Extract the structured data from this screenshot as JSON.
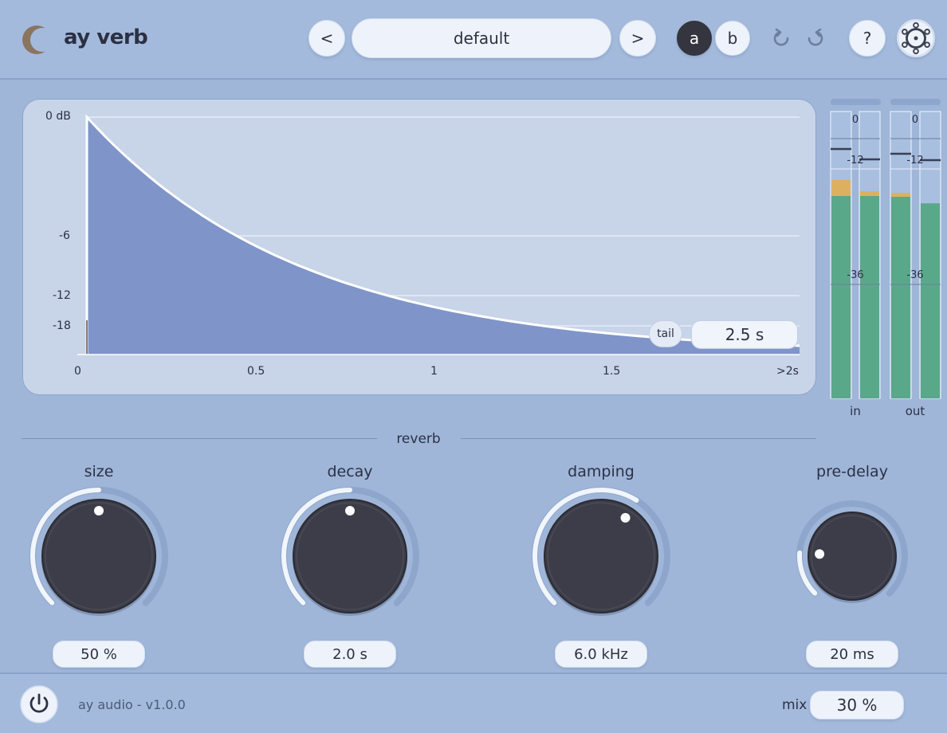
{
  "app": {
    "title": "ay verb"
  },
  "header": {
    "prev_label": "<",
    "next_label": ">",
    "preset_name": "default",
    "ab_a": "a",
    "ab_b": "b",
    "help_label": "?",
    "icons": {
      "logo": "moon-logo-icon",
      "undo": "undo-icon",
      "redo": "redo-icon",
      "settings": "gear-icon"
    }
  },
  "graph": {
    "y_ticks": [
      "0 dB",
      "-6",
      "-12",
      "-18"
    ],
    "x_ticks": [
      "0",
      "0.5",
      "1",
      "1.5",
      ">2s"
    ],
    "tail_label": "tail",
    "tail_value": "2.5 s"
  },
  "meters": {
    "scale": [
      "0",
      "-12",
      "-36"
    ],
    "in_label": "in",
    "out_label": "out",
    "in_left_level": 0.71,
    "in_right_level": 0.71,
    "out_left_level": 0.71,
    "out_right_level": 0.68
  },
  "section": {
    "title": "reverb"
  },
  "knobs": [
    {
      "label": "size",
      "value": "50 %",
      "position": 0.5
    },
    {
      "label": "decay",
      "value": "2.0 s",
      "position": 0.5
    },
    {
      "label": "damping",
      "value": "6.0 kHz",
      "position": 0.62
    },
    {
      "label": "pre-delay",
      "value": "20 ms",
      "position": 0.18
    }
  ],
  "footer": {
    "brand": "ay audio",
    "separator": "-",
    "version": "v1.0.0",
    "mix_label": "mix",
    "mix_value": "30 %",
    "power_icon": "power-icon"
  },
  "colors": {
    "background": "#9fb6d9",
    "fill": "#7f94c8",
    "meter_green": "#5aa88a",
    "meter_yellow": "#ddb060",
    "knob": "#3c3d48"
  }
}
